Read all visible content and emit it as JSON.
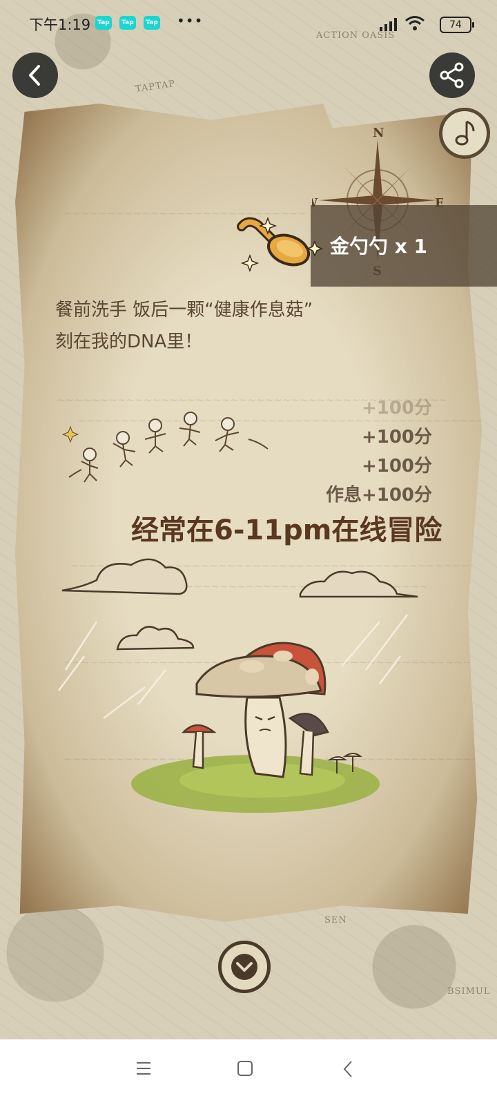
{
  "status_bar": {
    "time": "下午1:19",
    "tap_badges": [
      "Tap",
      "Tap",
      "Tap"
    ],
    "more": "•••",
    "battery": "74"
  },
  "map_labels": {
    "top": "ACTION OASIS",
    "top_left": "TAPTAP",
    "bottom": "SEN",
    "bottom_right": "BSIMUL"
  },
  "header": {
    "back_icon": "back-chevron-icon",
    "share_icon": "share-icon",
    "music_icon": "music-note-icon"
  },
  "compass": {
    "n": "N",
    "s": "S",
    "e": "E",
    "w": "W"
  },
  "reward": {
    "label": "金勺勺 x 1"
  },
  "description": {
    "line1": "餐前洗手 饭后一颗“健康作息菇”",
    "line2": "刻在我的DNA里！"
  },
  "scores": {
    "faded": "+100分",
    "line1": "+100分",
    "line2": "+100分",
    "line3": "作息+100分"
  },
  "headline": "经常在6-11pm在线冒险",
  "footer": {
    "next_icon": "chevron-down-icon"
  },
  "colors": {
    "parchment": "#e6dcc2",
    "band": "#554637",
    "headline": "#5a3820",
    "mushroom_red": "#c8533a"
  }
}
